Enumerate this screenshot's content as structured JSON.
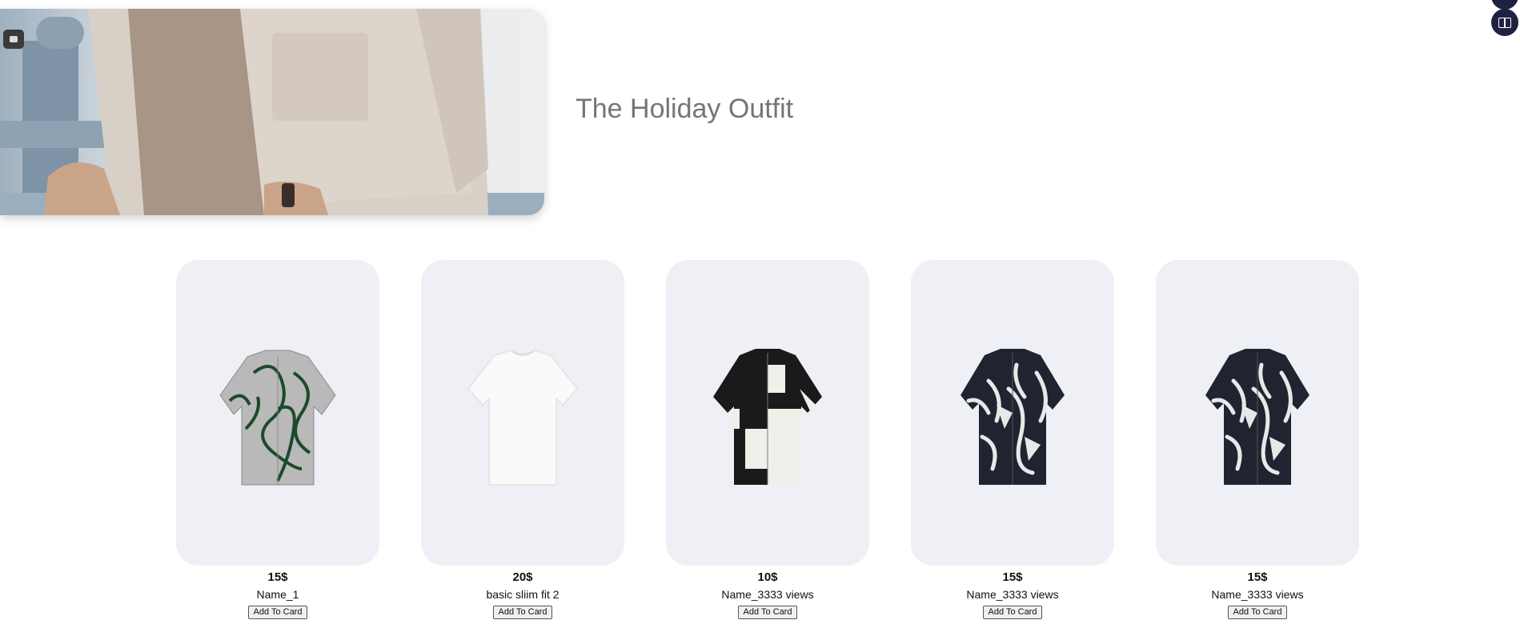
{
  "hero": {
    "title": "The Holiday Outfit"
  },
  "products": [
    {
      "price": "15$",
      "name": "Name_1",
      "button_label": "Add To Card",
      "pattern": "green-squiggle-shirt"
    },
    {
      "price": "20$",
      "name": "basic sliim fit 2",
      "button_label": "Add To Card",
      "pattern": "white-tshirt"
    },
    {
      "price": "10$",
      "name": "Name_3333 views",
      "button_label": "Add To Card",
      "pattern": "black-white-block-shirt"
    },
    {
      "price": "15$",
      "name": "Name_3333 views",
      "button_label": "Add To Card",
      "pattern": "navy-brush-shirt"
    },
    {
      "price": "15$",
      "name": "Name_3333 views",
      "button_label": "Add To Card",
      "pattern": "navy-brush-shirt"
    }
  ],
  "colors": {
    "card_background": "#eff0f5",
    "title": "#757575",
    "side_button": "#1f2140"
  }
}
